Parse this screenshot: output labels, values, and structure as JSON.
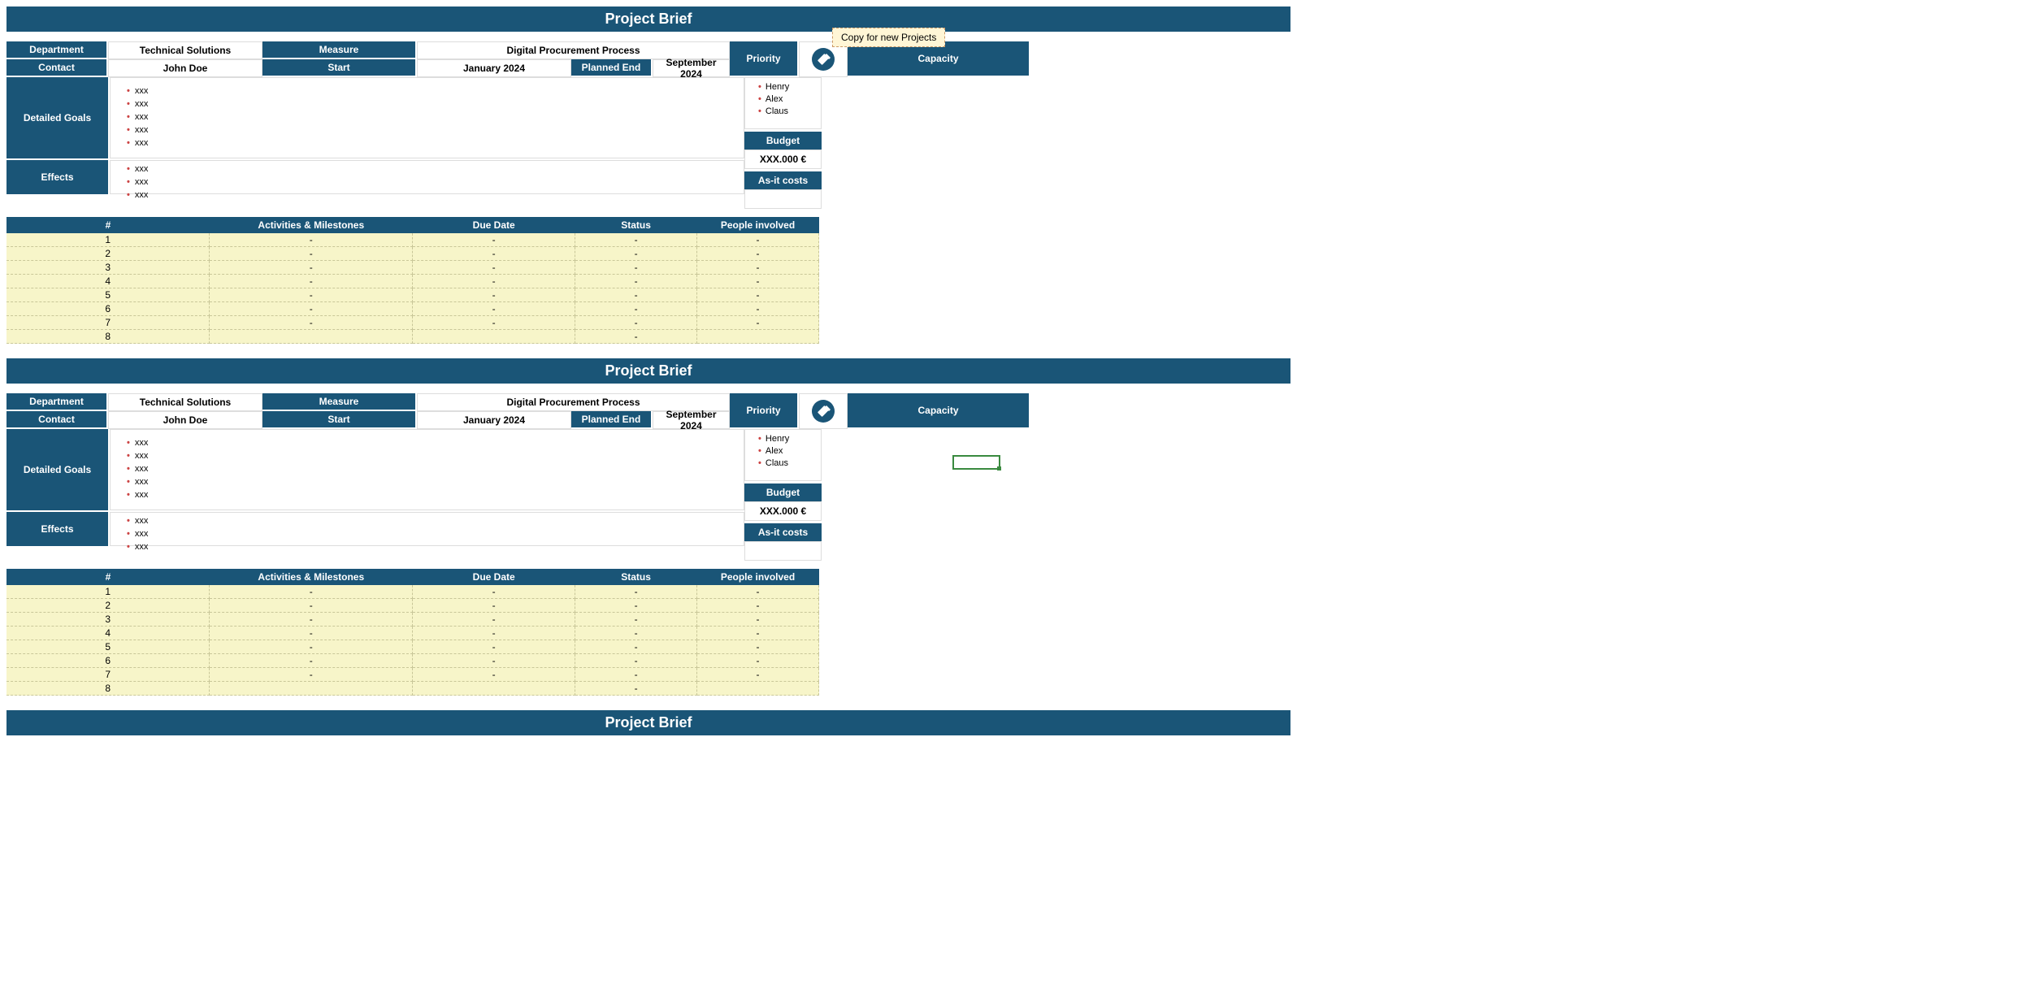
{
  "title": "Project Brief",
  "copy_note": "Copy for new Projects",
  "labels": {
    "department": "Department",
    "measure": "Measure",
    "priority": "Priority",
    "capacity": "Capacity",
    "contact": "Contact",
    "start": "Start",
    "planned_end": "Planned End",
    "detailed_goals": "Detailed Goals",
    "effects": "Effects",
    "budget": "Budget",
    "asit_costs": "As-it costs"
  },
  "values": {
    "department": "Technical Solutions",
    "measure": "Digital Procurement Process",
    "contact": "John Doe",
    "start": "January 2024",
    "planned_end": "September 2024",
    "budget": "XXX.000 €"
  },
  "goals": [
    "xxx",
    "xxx",
    "xxx",
    "xxx",
    "xxx"
  ],
  "effects": [
    "xxx",
    "xxx",
    "xxx"
  ],
  "capacity": [
    "Henry",
    "Alex",
    "Claus"
  ],
  "activities": {
    "headers": {
      "num": "#",
      "act": "Activities & Milestones",
      "due": "Due Date",
      "status": "Status",
      "people": "People involved"
    },
    "rows": [
      {
        "n": "1",
        "a": "-",
        "d": "-",
        "s": "-",
        "p": "-"
      },
      {
        "n": "2",
        "a": "-",
        "d": "-",
        "s": "-",
        "p": "-"
      },
      {
        "n": "3",
        "a": "-",
        "d": "-",
        "s": "-",
        "p": "-"
      },
      {
        "n": "4",
        "a": "-",
        "d": "-",
        "s": "-",
        "p": "-"
      },
      {
        "n": "5",
        "a": "-",
        "d": "-",
        "s": "-",
        "p": "-"
      },
      {
        "n": "6",
        "a": "-",
        "d": "-",
        "s": "-",
        "p": "-"
      },
      {
        "n": "7",
        "a": "-",
        "d": "-",
        "s": "-",
        "p": "-"
      },
      {
        "n": "8",
        "a": "",
        "d": "",
        "s": "-",
        "p": ""
      }
    ]
  }
}
